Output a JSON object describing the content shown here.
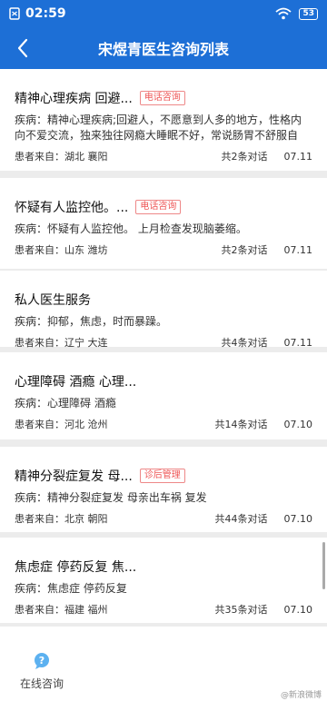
{
  "status_bar": {
    "time": "02:59",
    "battery": "53"
  },
  "nav": {
    "title": "宋煜青医生咨询列表"
  },
  "consultations": [
    {
      "title": "精神心理疾病 回避...",
      "tag": "电话咨询",
      "disease": "疾病：精神心理疾病;回避人，不愿意到人多的地方，性格内向不爱交流，独来独往网瘾大睡眠不好，常说肠胃不舒服自",
      "location": "患者来自：湖北 襄阳",
      "count": "共2条对话",
      "date": "07.11"
    },
    {
      "title": "怀疑有人监控他。...",
      "tag": "电话咨询",
      "disease": "疾病：怀疑有人监控他。 上月检查发现脑萎缩。",
      "location": "患者来自：山东 潍坊",
      "count": "共2条对话",
      "date": "07.11"
    },
    {
      "title": "私人医生服务",
      "tag": "",
      "disease": "疾病：抑郁，焦虑，时而暴躁。",
      "location": "患者来自：辽宁 大连",
      "count": "共4条对话",
      "date": "07.11"
    },
    {
      "title": "心理障碍 酒瘾 心理...",
      "tag": "",
      "disease": "疾病：心理障碍 酒瘾",
      "location": "患者来自：河北 沧州",
      "count": "共14条对话",
      "date": "07.10"
    },
    {
      "title": "精神分裂症复发 母...",
      "tag": "诊后管理",
      "disease": "疾病：精神分裂症复发 母亲出车祸 复发",
      "location": "患者来自：北京 朝阳",
      "count": "共44条对话",
      "date": "07.10"
    },
    {
      "title": "焦虑症 停药反复 焦...",
      "tag": "",
      "disease": "疾病：焦虑症 停药反复",
      "location": "患者来自：福建 福州",
      "count": "共35条对话",
      "date": "07.10"
    }
  ],
  "tabbar": {
    "label": "在线咨询"
  },
  "watermark": "@新浪微博"
}
